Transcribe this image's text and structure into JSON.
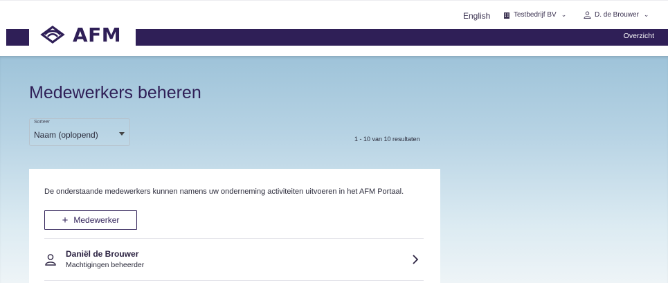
{
  "topbar": {
    "language": "English",
    "company": "Testbedrijf BV",
    "user": "D. de Brouwer",
    "caret": "⌄"
  },
  "brand": {
    "logo_text": "AFM",
    "logo_icon": "afm-logo-mark",
    "color": "#2f1f57"
  },
  "nav": {
    "overview": "Overzicht"
  },
  "page": {
    "title": "Medewerkers beheren"
  },
  "sort": {
    "label": "Sorteer",
    "value": "Naam (oplopend)"
  },
  "results": {
    "count_text": "1 - 10 van 10 resultaten"
  },
  "card": {
    "intro": "De onderstaande medewerkers kunnen namens uw onderneming activiteiten uitvoeren in het AFM Portaal.",
    "add_button": {
      "plus": "+",
      "label": "Medewerker"
    },
    "employees": [
      {
        "name": "Daniël de Brouwer",
        "role": "Machtigingen beheerder"
      }
    ]
  },
  "colors": {
    "hero_top": "#9ec3d9",
    "hero_bottom": "#eef4f7",
    "accent": "#2f1f57"
  }
}
